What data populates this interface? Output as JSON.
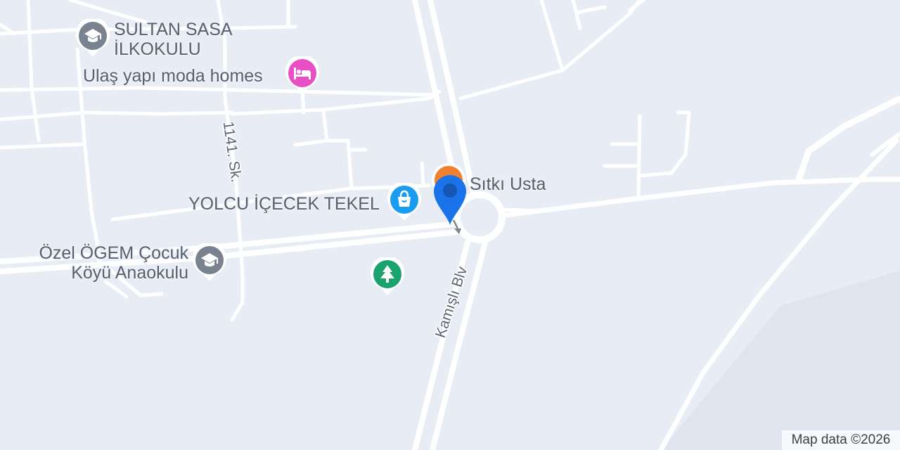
{
  "map": {
    "pois": [
      {
        "id": "sultan-sasa",
        "lines": [
          "SULTAN SASA",
          "İLKOKULU"
        ],
        "icon": "school-icon",
        "color": "#78838f"
      },
      {
        "id": "ulas-yapi",
        "lines": [
          "Ulaş yapı moda homes"
        ],
        "icon": "hotel-icon",
        "color": "#e94fc5"
      },
      {
        "id": "sitki-usta",
        "lines": [
          "Sıtkı Usta"
        ],
        "icon": "restaurant-icon",
        "color": "#f0802e"
      },
      {
        "id": "yolcu-icecek",
        "lines": [
          "YOLCU İÇECEK TEKEL"
        ],
        "icon": "shopping-bag-icon",
        "color": "#1a9cf0"
      },
      {
        "id": "ozel-ogem",
        "lines": [
          "Özel ÖGEM Çocuk",
          "Köyü Anaokulu"
        ],
        "icon": "school-icon",
        "color": "#78838f"
      },
      {
        "id": "park",
        "lines": [],
        "icon": "park-tree-icon",
        "color": "#1aa36f"
      }
    ],
    "streets": {
      "sk1141": "1141. Sk.",
      "kamisli": "Kamışlı Blv"
    },
    "location_pin": {
      "icon": "location-pin-icon",
      "color": "#1a73e8"
    },
    "attribution": "Map data ©2026"
  }
}
